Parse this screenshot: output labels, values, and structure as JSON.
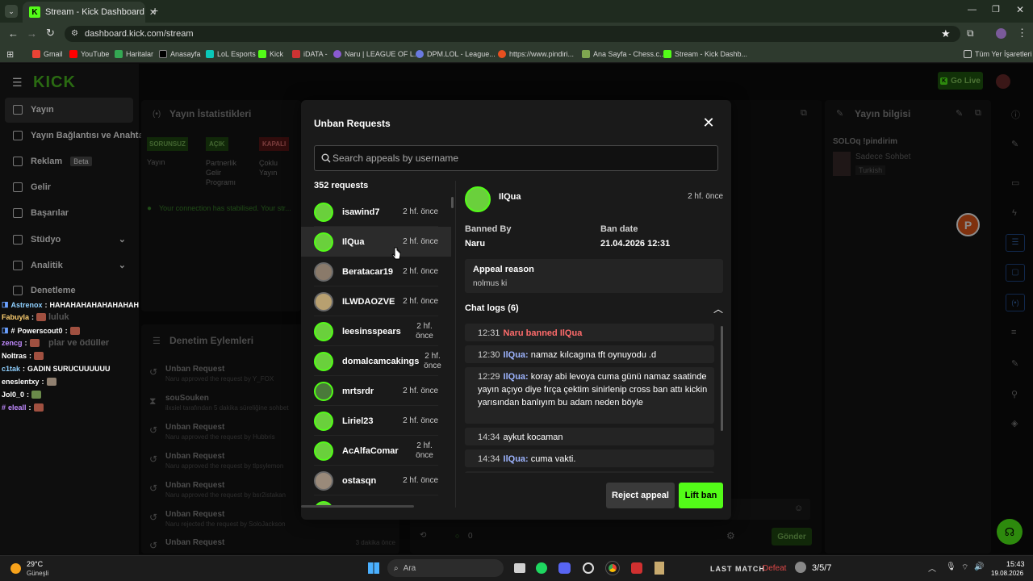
{
  "browser": {
    "tab_title": "Stream - Kick Dashboard",
    "url": "dashboard.kick.com/stream",
    "bookmarks": [
      "Gmail",
      "YouTube",
      "Haritalar",
      "Anasayfa",
      "LoL Esports",
      "Kick",
      "iDATA -",
      "Naru | LEAGUE OF L...",
      "DPM.LOL - League...",
      "https://www.pindiri...",
      "Ana Sayfa - Chess.c...",
      "Stream - Kick Dashb..."
    ],
    "all_bookmarks": "Tüm Yer İşaretleri"
  },
  "header": {
    "logo": "KICK",
    "go_live": "Go Live"
  },
  "sidebar": {
    "items": [
      "Yayın",
      "Yayın Bağlantısı ve Anahtarı",
      "Reklam",
      "Gelir",
      "Başarılar",
      "Stüdyo",
      "Analitik",
      "Denetleme"
    ],
    "beta": "Beta",
    "partial_1": "luluk",
    "partial_2": "plar ve ödüller"
  },
  "background": {
    "stats_title": "Yayın İstatistikleri",
    "badges": [
      "SORUNSUZ",
      "AÇIK",
      "KAPALI"
    ],
    "badge_labels": [
      "Yayın",
      "Partnerlik Gelir Programı",
      "Çoklu Yayın"
    ],
    "connection": "Your connection has stabilised. Your str...",
    "mod_title": "Denetim Eylemleri",
    "mod_actions": [
      {
        "title": "Unban Request",
        "sub": "Naru approved the request by Y_FOX"
      },
      {
        "title": "souSouken",
        "sub": "ilxsiel tarafından 5 dakika süreliğine sohbet"
      },
      {
        "title": "Unban Request",
        "sub": "Naru approved the request by Hubbris"
      },
      {
        "title": "Unban Request",
        "sub": "Naru approved the request by tlpsylemon"
      },
      {
        "title": "Unban Request",
        "sub": "Naru approved the request by bsr2istakan"
      },
      {
        "title": "Unban Request",
        "sub": "Naru rejected the request by SoloJackson"
      },
      {
        "title": "Unban Request",
        "sub": "",
        "time": "3 dakika önce"
      }
    ],
    "info_title": "Yayın bilgisi",
    "stream_name": "SOLOq !pindirim",
    "category": "Sadece Sohbet",
    "language": "Turkish",
    "send": "Gönder",
    "viewers": "0"
  },
  "chat_overlay": [
    {
      "user": "Astrenox",
      "msg": "HAHAHAHAHAHAHAHAH"
    },
    {
      "user": "Fabuyla",
      "msg": ""
    },
    {
      "user": "Powerscout0",
      "msg": ""
    },
    {
      "user": "zencg",
      "msg": ""
    },
    {
      "user": "Noltras",
      "msg": ""
    },
    {
      "user": "c1tak",
      "msg": "GADIN SURUCUUUUUU"
    },
    {
      "user": "eneslentxy",
      "msg": ""
    },
    {
      "user": "Jol0_0",
      "msg": ""
    },
    {
      "user": "eleall",
      "msg": ""
    }
  ],
  "modal": {
    "title": "Unban Requests",
    "search_placeholder": "Search appeals by username",
    "count": "352 requests",
    "requests": [
      {
        "name": "isawind7",
        "time": "2 hf. önce"
      },
      {
        "name": "IlQua",
        "time": "2 hf. önce"
      },
      {
        "name": "Beratacar19",
        "time": "2 hf. önce"
      },
      {
        "name": "ILWDAOZVE",
        "time": "2 hf. önce"
      },
      {
        "name": "leesinsspears",
        "time": "2 hf. önce"
      },
      {
        "name": "domalcamcakings",
        "time": "2 hf. önce"
      },
      {
        "name": "mrtsrdr",
        "time": "2 hf. önce"
      },
      {
        "name": "Liriel23",
        "time": "2 hf. önce"
      },
      {
        "name": "AcAlfaComar",
        "time": "2 hf. önce"
      },
      {
        "name": "ostasqn",
        "time": "2 hf. önce"
      }
    ],
    "detail": {
      "user": "IlQua",
      "time": "2 hf. önce",
      "banned_by_label": "Banned By",
      "banned_by": "Naru",
      "ban_date_label": "Ban date",
      "ban_date": "21.04.2026 12:31",
      "reason_label": "Appeal reason",
      "reason": "nolmus ki",
      "chat_logs_label": "Chat logs (6)",
      "logs": [
        {
          "time": "12:31",
          "user": "",
          "text": "Naru banned IlQua"
        },
        {
          "time": "12:30",
          "user": "IlQua:",
          "text": "namaz kılcagına tft oynuyodu .d"
        },
        {
          "time": "12:29",
          "user": "IlQua:",
          "text": "koray abi levoya cuma günü namaz saatinde yayın açıyo diye fırça çektim sinirlenip cross ban attı kickin yarısından banlıyım bu adam neden böyle"
        },
        {
          "time": "14:34",
          "user": "",
          "text": "aykut kocaman"
        },
        {
          "time": "14:34",
          "user": "IlQua:",
          "text": "cuma vakti."
        }
      ]
    },
    "reject": "Reject appeal",
    "lift": "Lift ban"
  },
  "taskbar": {
    "weather_temp": "29°C",
    "weather_desc": "Güneşli",
    "search": "Ara",
    "last_match_label": "LAST MATCH",
    "last_match_result": "Defeat",
    "kda": "3/5/7",
    "time": "15:43",
    "date": "19.08.2026"
  },
  "colors": {
    "accent": "#53fc18",
    "ban_red": "#ff6b6b",
    "user_blue": "#9db4ff"
  }
}
